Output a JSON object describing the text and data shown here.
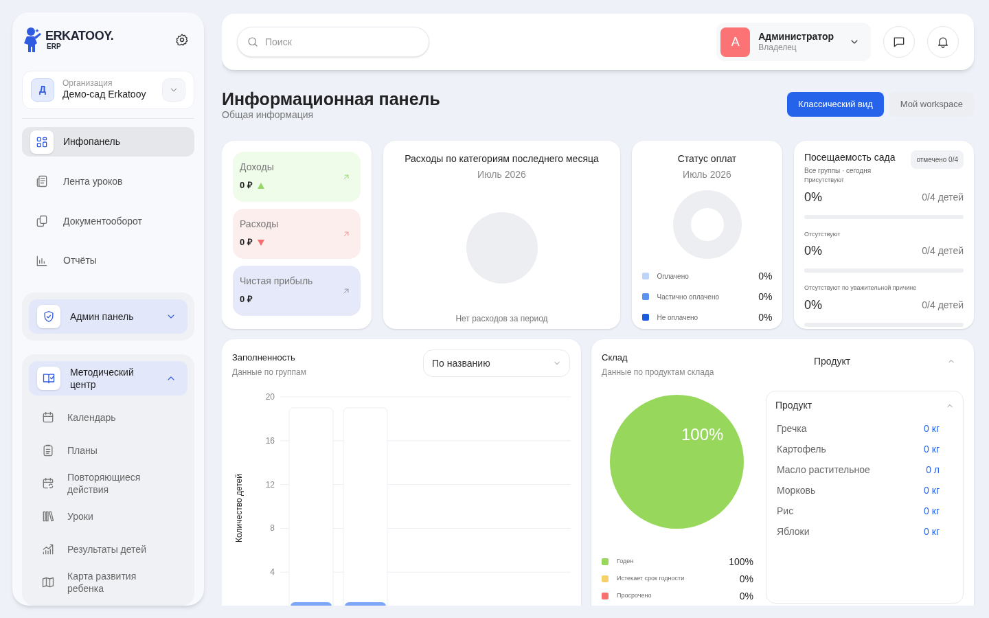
{
  "sidebar": {
    "logo": {
      "name": "ERKATOOY.",
      "sub": "ERP"
    },
    "org": {
      "initial": "Д",
      "label": "Организация",
      "name": "Демо-сад Erkatooy"
    },
    "nav": [
      {
        "label": "Инфопанель",
        "selected": true
      },
      {
        "label": "Лента уроков",
        "selected": false
      },
      {
        "label": "Документооборот",
        "selected": false
      },
      {
        "label": "Отчёты",
        "selected": false
      }
    ],
    "groups": [
      {
        "label": "Админ панель",
        "expanded": false
      },
      {
        "label": "Методический центр",
        "expanded": true,
        "children": [
          {
            "label": "Календарь"
          },
          {
            "label": "Планы"
          },
          {
            "label": "Повторяющиеся действия"
          },
          {
            "label": "Уроки"
          },
          {
            "label": "Результаты детей"
          },
          {
            "label": "Карта развития ребенка"
          }
        ]
      }
    ]
  },
  "topbar": {
    "search": {
      "placeholder": "Поиск"
    },
    "user": {
      "initial": "А",
      "name": "Администратор",
      "role": "Владелец"
    }
  },
  "header": {
    "title": "Информационная панель",
    "subtitle": "Общая информация",
    "views": [
      {
        "label": "Классический вид",
        "selected": true
      },
      {
        "label": "Мой workspace",
        "selected": false
      }
    ]
  },
  "finance": [
    {
      "kind": "income",
      "label": "Доходы",
      "value": "0 ₽"
    },
    {
      "kind": "expense",
      "label": "Расходы",
      "value": "0 ₽"
    },
    {
      "kind": "profit",
      "label": "Чистая прибыль",
      "value": "0 ₽"
    }
  ],
  "expenses_chart": {
    "title": "Расходы по категориям последнего месяца",
    "period": "Июль 2026",
    "empty_text": "Нет расходов за период"
  },
  "payment_status": {
    "title": "Статус оплат",
    "period": "Июль 2026",
    "legend": [
      {
        "label": "Оплачено",
        "value": "0%",
        "color": "#bfd4fb"
      },
      {
        "label": "Частично оплачено",
        "value": "0%",
        "color": "#5b93f5"
      },
      {
        "label": "Не оплачено",
        "value": "0%",
        "color": "#1d5be0"
      }
    ]
  },
  "attendance": {
    "title": "Посещаемость сада",
    "badge": "отмечено 0/4",
    "subtitle": "Все группы · сегодня",
    "rows": [
      {
        "label": "Присутствуют",
        "percent": "0%",
        "count": "0/4 детей",
        "level": 0
      },
      {
        "label": "Отсутствуют",
        "percent": "0%",
        "count": "0/4 детей",
        "level": 0
      },
      {
        "label": "Отсутствуют по уважительной причине",
        "percent": "0%",
        "count": "0/4 детей",
        "level": 0
      }
    ]
  },
  "occupancy": {
    "title": "Заполненность",
    "subtitle": "Данные по группам",
    "sort": "По названию",
    "y_axis": {
      "label": "Количество детей",
      "ticks": [
        "20",
        "16",
        "12",
        "8",
        "4"
      ]
    }
  },
  "warehouse": {
    "title": "Склад",
    "subtitle": "Данные по продуктам склада",
    "filter": "Продукт",
    "pie_label": "100%",
    "legend": [
      {
        "label": "Годен",
        "value": "100%",
        "color": "#97d85c"
      },
      {
        "label": "Истекает срок годности",
        "value": "0%",
        "color": "#f5d16b"
      },
      {
        "label": "Просрочено",
        "value": "0%",
        "color": "#f87171"
      }
    ],
    "products": {
      "header": "Продукт",
      "expanded": true,
      "items": [
        {
          "name": "Гречка",
          "amount": "0 кг"
        },
        {
          "name": "Картофель",
          "amount": "0 кг"
        },
        {
          "name": "Масло растительное",
          "amount": "0 л"
        },
        {
          "name": "Морковь",
          "amount": "0 кг"
        },
        {
          "name": "Рис",
          "amount": "0 кг"
        },
        {
          "name": "Яблоки",
          "amount": "0 кг"
        }
      ]
    }
  }
}
